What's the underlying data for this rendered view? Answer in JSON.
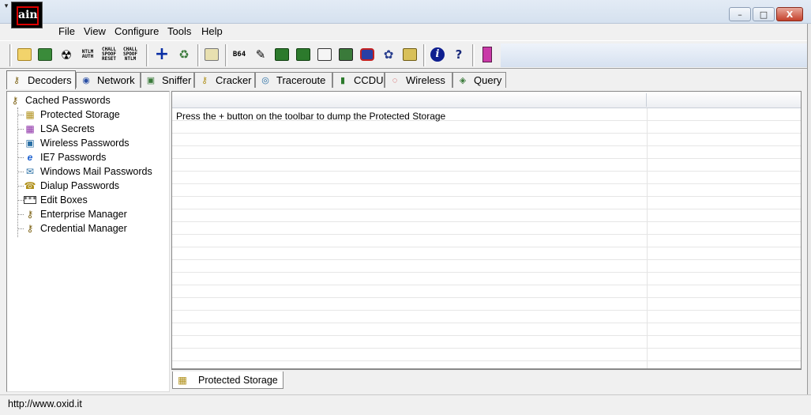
{
  "window": {
    "logo_text": "ain",
    "minimize": "–",
    "maximize": "□",
    "close": "X"
  },
  "menu": [
    "File",
    "View",
    "Configure",
    "Tools",
    "Help"
  ],
  "toolbar": {
    "b64_label": "B64",
    "ntlm_auth_label": "NTLM AUTH",
    "chall_spoof_reset_label": "CHALL SPOOF RESET",
    "chall_spoof_ntlm_label": "CHALL SPOOF NTLM",
    "help_icon": "?"
  },
  "tabs": [
    "Decoders",
    "Network",
    "Sniffer",
    "Cracker",
    "Traceroute",
    "CCDU",
    "Wireless",
    "Query"
  ],
  "active_tab": "Decoders",
  "tree": {
    "root": "Cached Passwords",
    "children": [
      "Protected Storage",
      "LSA Secrets",
      "Wireless Passwords",
      "IE7 Passwords",
      "Windows Mail Passwords",
      "Dialup Passwords",
      "Edit Boxes",
      "Enterprise Manager",
      "Credential Manager"
    ]
  },
  "listview": {
    "message": "Press the + button on the toolbar to dump the Protected Storage"
  },
  "bottom_tab": "Protected Storage",
  "status": "http://www.oxid.it"
}
